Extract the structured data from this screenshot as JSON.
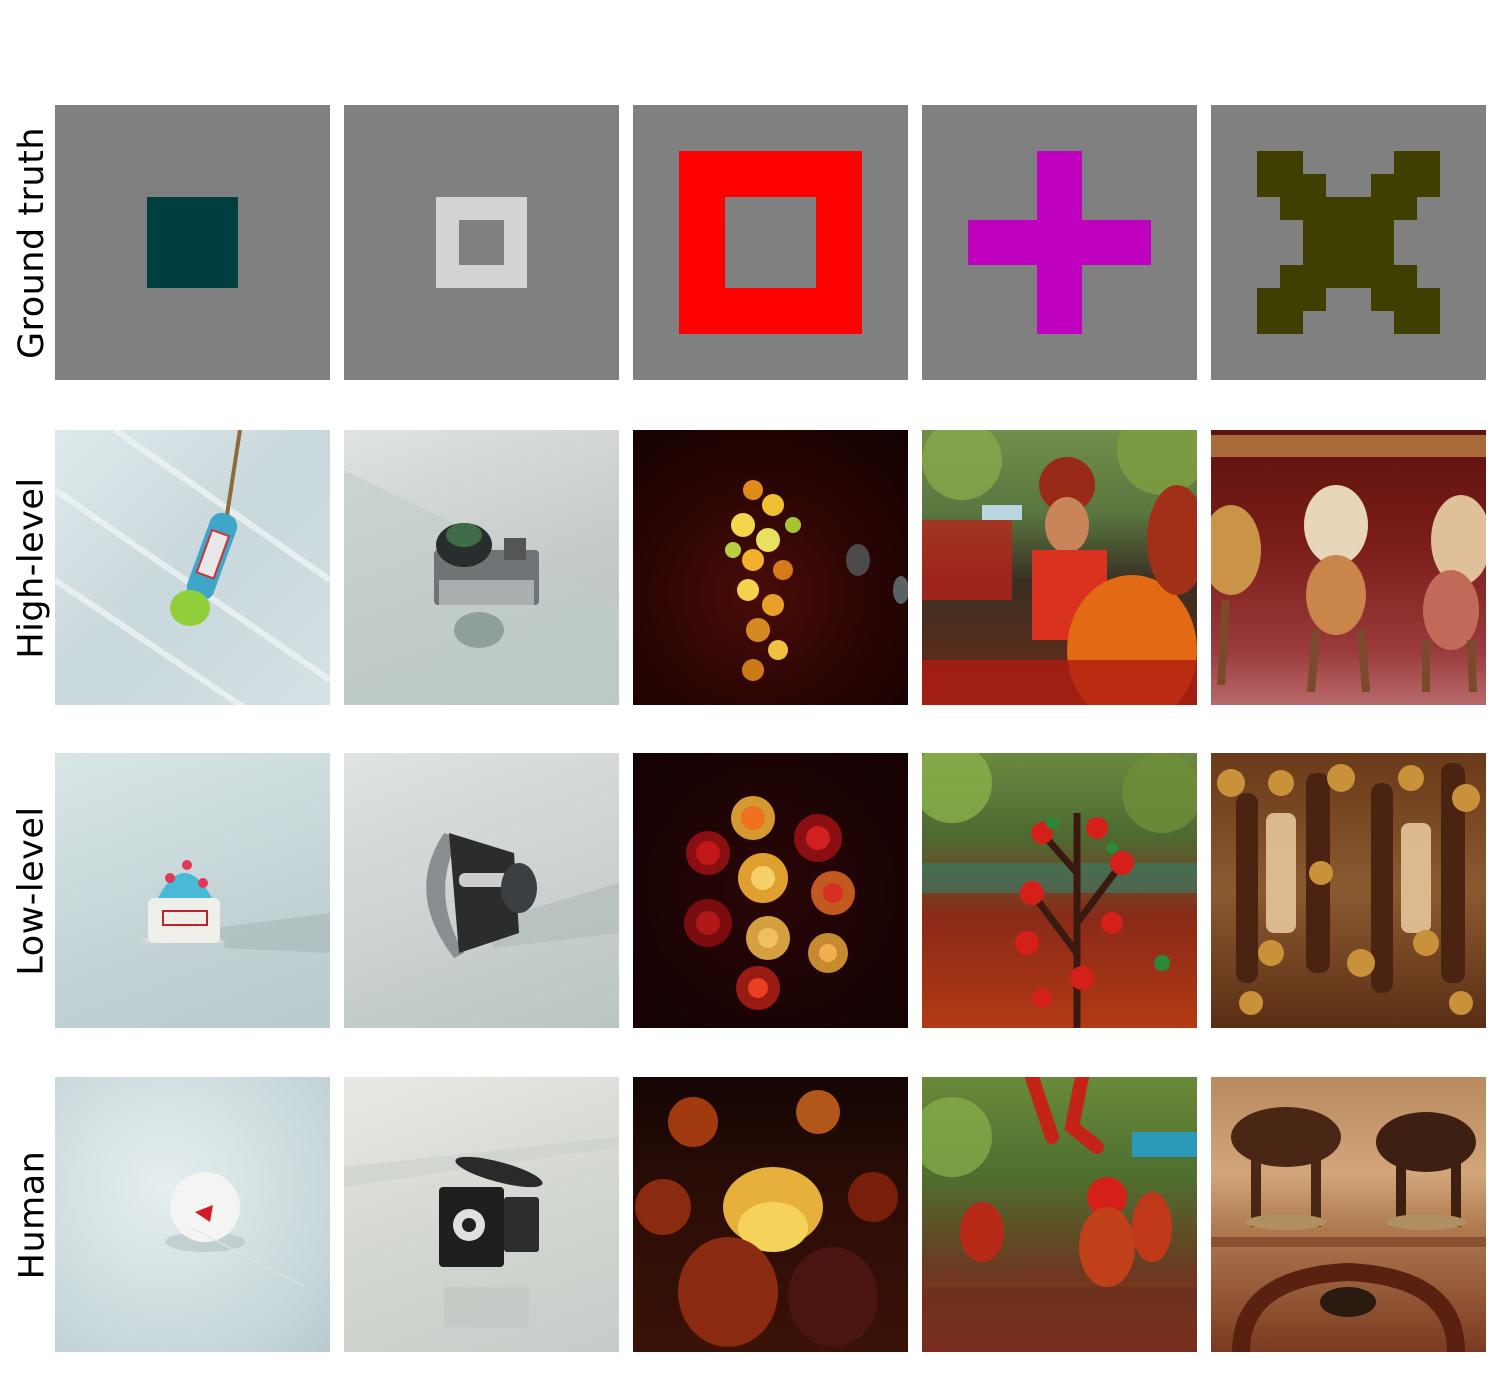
{
  "rows": [
    {
      "label": "Ground truth"
    },
    {
      "label": "High-level"
    },
    {
      "label": "Low-level"
    },
    {
      "label": "Human"
    }
  ],
  "ground_truth_colors": [
    "#003f3f",
    "#d3d3d3",
    "#ff0000",
    "#bf00bf",
    "#3f3f00"
  ],
  "background_color": "#808080"
}
